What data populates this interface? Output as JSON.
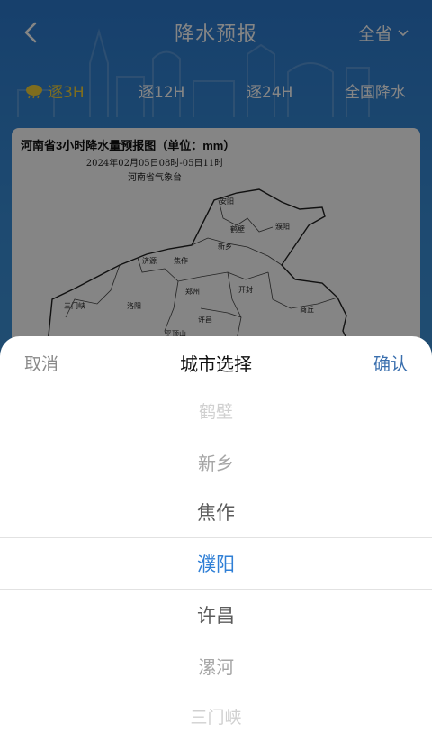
{
  "header": {
    "title": "降水预报",
    "region": "全省"
  },
  "tabs": [
    {
      "label": "逐3H",
      "active": true
    },
    {
      "label": "逐12H",
      "active": false
    },
    {
      "label": "逐24H",
      "active": false
    },
    {
      "label": "全国降水",
      "active": false
    }
  ],
  "map": {
    "title": "河南省3小时降水量预报图（单位：mm）",
    "date": "2024年02月05日08时-05日11时",
    "source": "河南省气象台",
    "labels": [
      "安阳",
      "鹤壁",
      "濮阳",
      "新乡",
      "济源",
      "焦作",
      "郑州",
      "开封",
      "商丘",
      "三门峡",
      "洛阳",
      "许昌",
      "平顶山"
    ]
  },
  "sheet": {
    "cancel": "取消",
    "title": "城市选择",
    "confirm": "确认",
    "options": [
      "鹤壁",
      "新乡",
      "焦作",
      "濮阳",
      "许昌",
      "漯河",
      "三门峡"
    ],
    "selected": "濮阳"
  },
  "colors": {
    "header_gradient_top": "#2c7bd0",
    "active_tab": "#f2d23a",
    "selected_option": "#2f7fd6",
    "confirm": "#3a6fae"
  }
}
